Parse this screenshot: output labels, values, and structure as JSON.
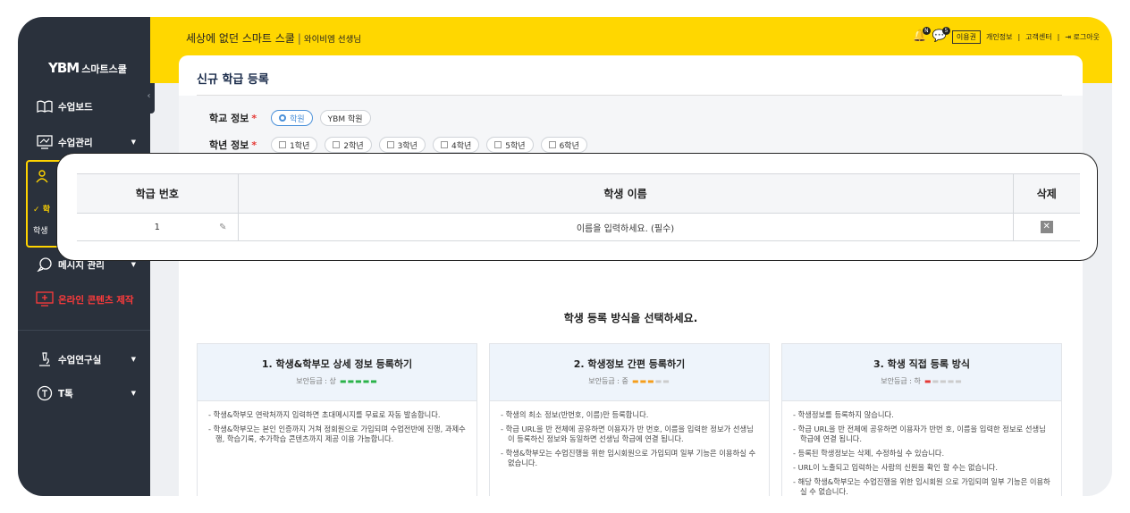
{
  "sidebar": {
    "logo_mark": "YBM",
    "logo_text": "스마트스쿨",
    "collapse_icon": "‹",
    "items": [
      {
        "label": "수업보드",
        "icon": "book-icon"
      },
      {
        "label": "수업관리",
        "icon": "monitor-icon",
        "arrow": "▼"
      },
      {
        "label": "메시지 관리",
        "icon": "message-icon",
        "arrow": "▼"
      },
      {
        "label": "온라인 콘텐츠 제작",
        "icon": "screen-icon"
      },
      {
        "label": "수업연구실",
        "icon": "microscope-icon",
        "arrow": "▼"
      },
      {
        "label": "T톡",
        "icon": "t-icon",
        "arrow": "▼"
      }
    ],
    "active_sub": [
      "학",
      "학생"
    ]
  },
  "header": {
    "school": "세상에 없던 스마트 스쿨",
    "separator": "|",
    "teacher": "와이비엠 선생님",
    "notif_badge": "N",
    "msg_badge": "5",
    "plan_label": "이용권",
    "links": [
      "개인정보",
      "|",
      "고객센터",
      "|",
      "⇥ 로그아웃"
    ]
  },
  "page": {
    "title": "신규 학급 등록",
    "school_info_label": "학교 정보",
    "grade_info_label": "학년 정보",
    "required_mark": "*",
    "school_options": [
      "학원",
      "YBM 학원"
    ],
    "grade_options": [
      "1학년",
      "2학년",
      "3학년",
      "4학년",
      "5학년",
      "6학년"
    ]
  },
  "table": {
    "headers": [
      "학급 번호",
      "학생 이름",
      "삭제"
    ],
    "row_number": "1",
    "name_placeholder": "이름을 입력하세요. (필수)",
    "delete_icon": "✕"
  },
  "methods": {
    "title": "학생 등록 방식을 선택하세요.",
    "cards": [
      {
        "title": "1. 학생&학부모 상세 정보 등록하기",
        "security": "보안등급 : 상",
        "dash_color": "#2bb34a",
        "bullets": [
          "학생&학부모 연락처까지 입력하면 초대메시지를 무료로 자동 발송합니다.",
          "학생&학부모는 본인 인증까지 거쳐 정회원으로 가입되며 수업전반에 진행, 과제수행, 학습기록, 추가학습 콘텐츠까지 제공 이용 가능합니다."
        ]
      },
      {
        "title": "2. 학생정보 간편 등록하기",
        "security": "보안등급 : 중",
        "dash_color": "#f59e1b",
        "bullets": [
          "학생의 최소 정보(반번호, 이름)만 등록합니다.",
          "학급 URL을 반 전체에 공유하면 이용자가 반 번호, 이름을 입력한 정보가 선생님이 등록하신 정보와 동일하면 선생님 학급에 연결 됩니다.",
          "학생&학부모는 수업진행을 위한 임시회원으로 가입되며 일부 기능은 이용하실 수 없습니다."
        ]
      },
      {
        "title": "3. 학생 직접 등록 방식",
        "security": "보안등급 : 하",
        "dash_color": "#e53935",
        "bullets": [
          "학생정보를 등록하지 않습니다.",
          "학급 URL을 반 전체에 공유하면 이용자가 반번 호, 이름을 입력한 정보로 선생님 학급에 연결 됩니다.",
          "등록된 학생정보는 삭제, 수정하실 수 있습니다.",
          "URL이 노출되고 입력하는 사람의 신원을 확인 할 수는 없습니다.",
          "해당 학생&학부모는 수업진행을 위한 임시회원 으로 가입되며 일부 기능은 이용하실 수 없습니다."
        ]
      }
    ]
  },
  "colors": {
    "accent": "#ffd700",
    "sidebar": "#2a313c",
    "link": "#4a90d9",
    "danger": "#e53935"
  }
}
